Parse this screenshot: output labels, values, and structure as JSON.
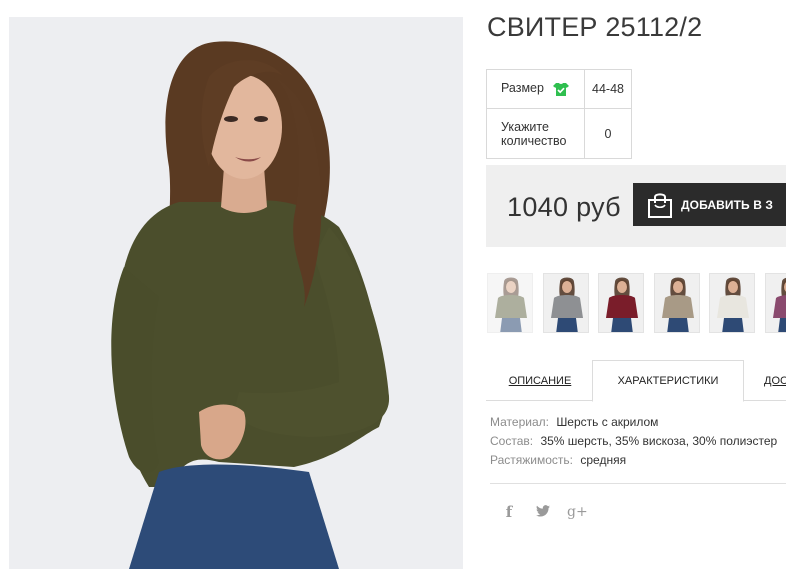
{
  "product": {
    "title": "СВИТЕР 25112/2",
    "image_alt": "woman in olive green knit sweater and jeans"
  },
  "options": {
    "size_label": "Размер",
    "size_value": "44-48",
    "qty_label_line1": "Укажите",
    "qty_label_line2": "количество",
    "qty_value": "0"
  },
  "purchase": {
    "price": "1040 руб",
    "add_button_label": "ДОБАВИТЬ В З"
  },
  "thumbnails": [
    {
      "color": "olive",
      "sweater": "#6b6f4f",
      "active": true
    },
    {
      "color": "grey",
      "sweater": "#8e9093"
    },
    {
      "color": "burgundy",
      "sweater": "#7a1d2a"
    },
    {
      "color": "beige",
      "sweater": "#a89a86"
    },
    {
      "color": "white",
      "sweater": "#e8e6df"
    },
    {
      "color": "purple",
      "sweater": "#8a4a6e"
    }
  ],
  "tabs": {
    "description": "ОПИСАНИЕ",
    "characteristics": "ХАРАКТЕРИСТИКИ",
    "delivery": "ДОС"
  },
  "properties": [
    {
      "key": "Материал:",
      "value": "Шерсть с акрилом"
    },
    {
      "key": "Состав:",
      "value": "35% шерсть, 35% вискоза, 30% полиэстер"
    },
    {
      "key": "Растяжимость:",
      "value": "средняя"
    }
  ],
  "social": {
    "facebook": "f",
    "twitter": "🐦",
    "google_plus": "g+"
  },
  "colors": {
    "button_bg": "#2b2b2b",
    "panel_bg": "#efefef",
    "check_green": "#2fbf4f",
    "divider": "#e0e0e0"
  }
}
